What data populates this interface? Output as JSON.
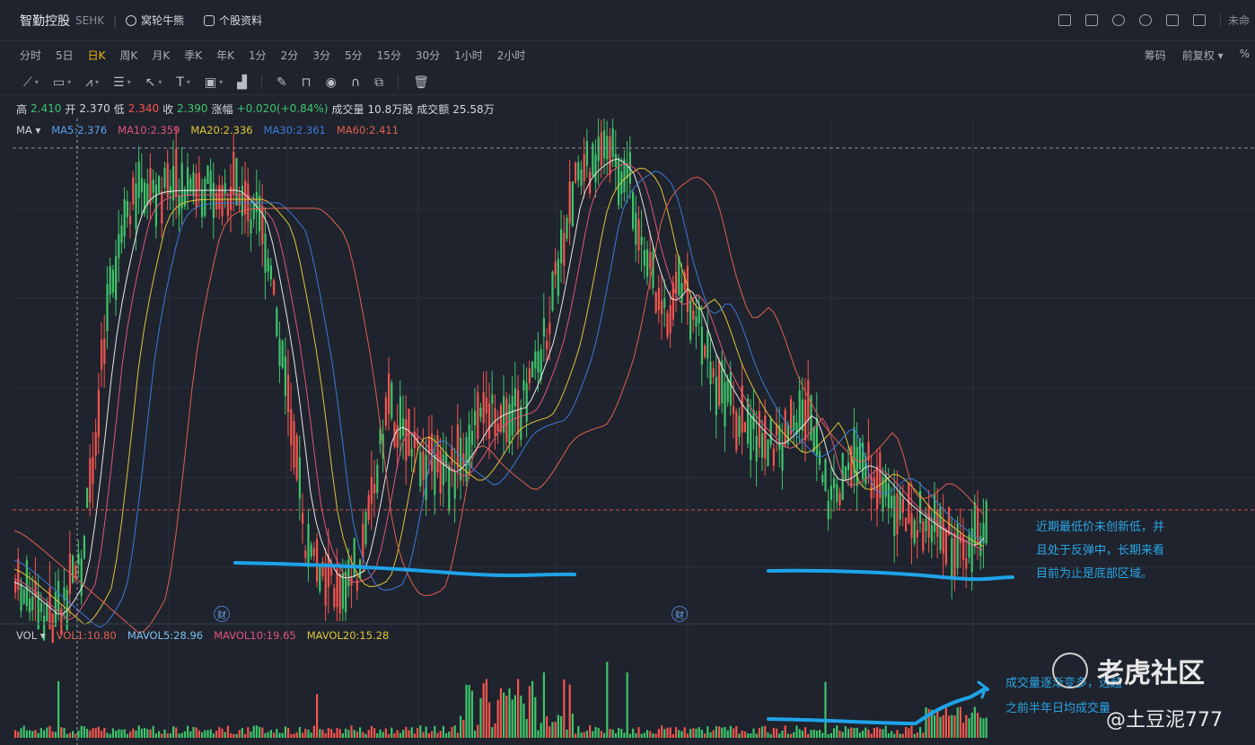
{
  "header": {
    "stock_name": "智勤控股",
    "exchange": "SEHK",
    "nest_label": "窝轮牛熊",
    "profile_label": "个股资料",
    "right_cut_text": "未命"
  },
  "periods": {
    "items": [
      "分时",
      "5日",
      "日K",
      "周K",
      "月K",
      "季K",
      "年K",
      "1分",
      "2分",
      "3分",
      "5分",
      "15分",
      "30分",
      "1小时",
      "2小时"
    ],
    "active": "日K",
    "chips_label": "筹码",
    "adjust_label": "前复权",
    "percent_label": "%"
  },
  "ohlc": {
    "high_label": "高",
    "high": "2.410",
    "open_label": "开",
    "open": "2.370",
    "low_label": "低",
    "low": "2.340",
    "close_label": "收",
    "close": "2.390",
    "change_label": "涨幅",
    "change": "+0.020(+0.84%)",
    "volume_label": "成交量",
    "volume": "10.8万股",
    "turnover_label": "成交额",
    "turnover": "25.58万"
  },
  "ma_legend": {
    "label": "MA",
    "ma5": "MA5:2.376",
    "ma10": "MA10:2.359",
    "ma20": "MA20:2.336",
    "ma30": "MA30:2.361",
    "ma60": "MA60:2.411"
  },
  "vol_legend": {
    "label": "VOL",
    "vol": "VOL1:10.80",
    "mavol5": "MAVOL5:28.96",
    "mavol10": "MAVOL10:19.65",
    "mavol20": "MAVOL20:15.28"
  },
  "badges": {
    "fin": "财"
  },
  "annotations": {
    "main": [
      "近期最低价未创新低，并",
      "且处于反弹中，长期来看",
      "目前为止是底部区域。"
    ],
    "volume": [
      "成交量逐渐变多，远超",
      "之前半年日均成交量"
    ]
  },
  "watermark": {
    "brand": "老虎社区",
    "user": "@土豆泥777"
  },
  "colors": {
    "up": "#f4544e",
    "down": "#3ec46a",
    "ma5": "#e8e8e8",
    "ma10": "#e0557a",
    "ma20": "#e0c43a",
    "ma30": "#3a7ad8",
    "ma60": "#e06050",
    "annotation": "#29a6e6",
    "active_period": "#f0b90b"
  },
  "chart_data": {
    "type": "candlestick",
    "symbol": "智勤控股 SEHK",
    "last_bar": {
      "open": 2.37,
      "high": 2.41,
      "low": 2.34,
      "close": 2.39,
      "change": "+0.020(+0.84%)"
    },
    "moving_averages": {
      "MA5": 2.376,
      "MA10": 2.359,
      "MA20": 2.336,
      "MA30": 2.361,
      "MA60": 2.411
    },
    "volume": {
      "VOL": 10.8,
      "MAVOL5": 28.96,
      "MAVOL10": 19.65,
      "MAVOL20": 15.28
    }
  }
}
